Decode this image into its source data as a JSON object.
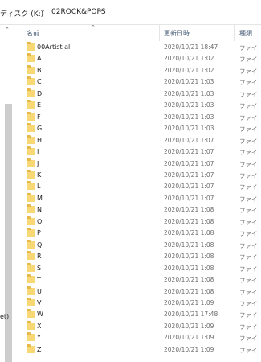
{
  "breadcrumb": {
    "items": [
      "ディスク (K:)",
      "02ROCK&POPS"
    ],
    "separator": "›"
  },
  "navigation_pane": {
    "scroll_up_glyph": "⌃",
    "partial_label": "et)"
  },
  "columns": {
    "name": "名前",
    "modified": "更新日時",
    "type": "種類",
    "sort_indicator": "⌃"
  },
  "files": [
    {
      "name": "00Artist all",
      "modified": "2020/10/21 18:47",
      "type": "ファイ"
    },
    {
      "name": "A",
      "modified": "2020/10/21 1:02",
      "type": "ファイ"
    },
    {
      "name": "B",
      "modified": "2020/10/21 1:02",
      "type": "ファイ"
    },
    {
      "name": "C",
      "modified": "2020/10/21 1:03",
      "type": "ファイ"
    },
    {
      "name": "D",
      "modified": "2020/10/21 1:03",
      "type": "ファイ"
    },
    {
      "name": "E",
      "modified": "2020/10/21 1:03",
      "type": "ファイ"
    },
    {
      "name": "F",
      "modified": "2020/10/21 1:03",
      "type": "ファイ"
    },
    {
      "name": "G",
      "modified": "2020/10/21 1:03",
      "type": "ファイ"
    },
    {
      "name": "H",
      "modified": "2020/10/21 1:07",
      "type": "ファイ"
    },
    {
      "name": "I",
      "modified": "2020/10/21 1:07",
      "type": "ファイ"
    },
    {
      "name": "J",
      "modified": "2020/10/21 1:07",
      "type": "ファイ"
    },
    {
      "name": "K",
      "modified": "2020/10/21 1:07",
      "type": "ファイ"
    },
    {
      "name": "L",
      "modified": "2020/10/21 1:07",
      "type": "ファイ"
    },
    {
      "name": "M",
      "modified": "2020/10/21 1:07",
      "type": "ファイ"
    },
    {
      "name": "N",
      "modified": "2020/10/21 1:08",
      "type": "ファイ"
    },
    {
      "name": "O",
      "modified": "2020/10/21 1:08",
      "type": "ファイ"
    },
    {
      "name": "P",
      "modified": "2020/10/21 1:08",
      "type": "ファイ"
    },
    {
      "name": "Q",
      "modified": "2020/10/21 1:08",
      "type": "ファイ"
    },
    {
      "name": "R",
      "modified": "2020/10/21 1:08",
      "type": "ファイ"
    },
    {
      "name": "S",
      "modified": "2020/10/21 1:08",
      "type": "ファイ"
    },
    {
      "name": "T",
      "modified": "2020/10/21 1:08",
      "type": "ファイ"
    },
    {
      "name": "U",
      "modified": "2020/10/21 1:08",
      "type": "ファイ"
    },
    {
      "name": "V",
      "modified": "2020/10/21 1:09",
      "type": "ファイ"
    },
    {
      "name": "W",
      "modified": "2020/10/21 17:48",
      "type": "ファイ"
    },
    {
      "name": "X",
      "modified": "2020/10/21 1:09",
      "type": "ファイ"
    },
    {
      "name": "Y",
      "modified": "2020/10/21 1:09",
      "type": "ファイ"
    },
    {
      "name": "Z",
      "modified": "2020/10/21 1:09",
      "type": "ファイ"
    }
  ],
  "icons": {
    "folder": "folder-icon",
    "breadcrumb_separator": "chevron-right-icon",
    "sort": "chevron-up-icon"
  },
  "colors": {
    "folder_body": "#f8d775",
    "folder_tab": "#e7b94b",
    "header_text": "#4c607a",
    "secondary_text": "#6d6d6d"
  }
}
